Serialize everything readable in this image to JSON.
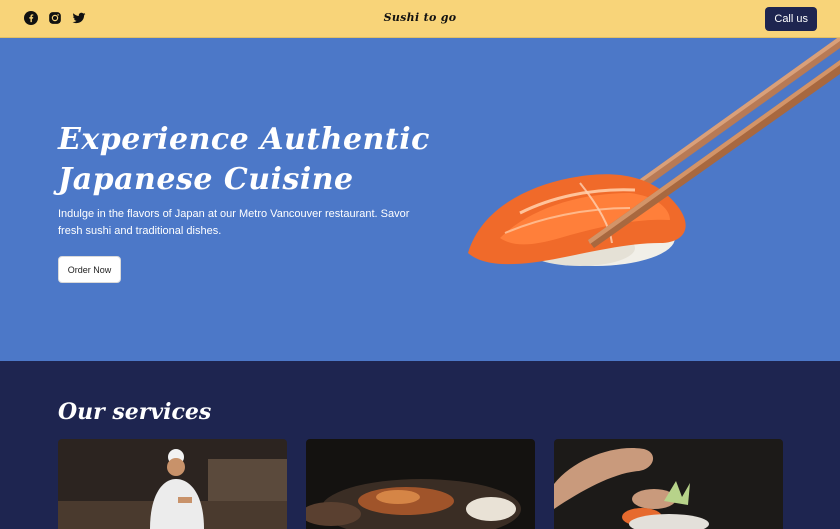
{
  "header": {
    "social_icons": [
      "facebook-icon",
      "instagram-icon",
      "twitter-icon"
    ],
    "brand": "Sushi to go",
    "call_label": "Call us"
  },
  "hero": {
    "title_line1": "Experience Authentic",
    "title_line2": "Japanese Cuisine",
    "description": "Indulge in the flavors of Japan at our Metro Vancouver restaurant. Savor fresh sushi and traditional dishes.",
    "order_label": "Order Now"
  },
  "services": {
    "title": "Our services",
    "cards": [
      "chef-image",
      "grilled-food-image",
      "plating-image"
    ]
  },
  "colors": {
    "header_bg": "#f8d479",
    "hero_bg": "#4c78c8",
    "services_bg": "#1e2550",
    "button_dark": "#1e2550"
  }
}
